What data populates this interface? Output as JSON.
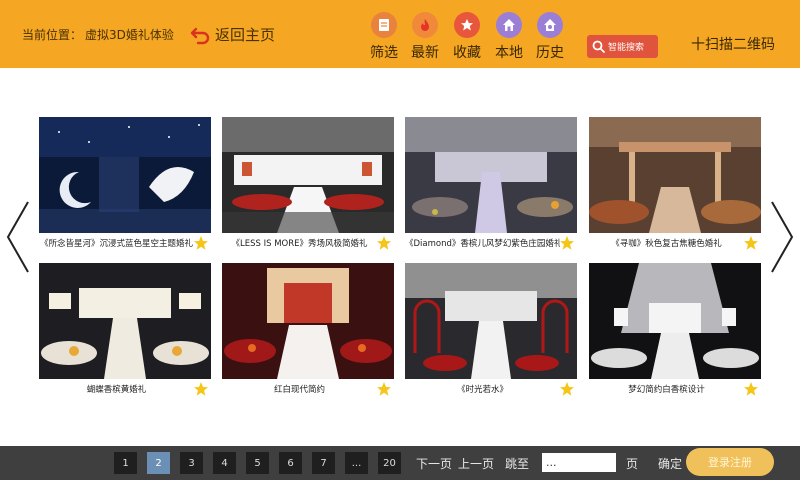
{
  "header": {
    "location_label": "当前位置：",
    "location_value": "虚拟3D婚礼体验",
    "back_label": "返回主页",
    "nav": [
      {
        "label": "筛选",
        "icon": "filter-icon",
        "color": "#e8823c"
      },
      {
        "label": "最新",
        "icon": "flame-icon",
        "color": "#f08a3a"
      },
      {
        "label": "收藏",
        "icon": "star-icon",
        "color": "#e8573c"
      },
      {
        "label": "本地",
        "icon": "home-icon",
        "color": "#9b7fd6"
      },
      {
        "label": "历史",
        "icon": "history-icon",
        "color": "#9b7fd6"
      }
    ],
    "search_label": "智能搜索",
    "qr_label": "十扫描二维码"
  },
  "cards": [
    {
      "caption": "《所念皆星河》沉浸式蓝色星空主题婚礼",
      "theme": "blue-starry"
    },
    {
      "caption": "《LESS IS MORE》秀场风极简婚礼",
      "theme": "red-white-runway"
    },
    {
      "caption": "《Diamond》香槟儿风梦幻紫色庄园婚礼",
      "theme": "purple-manor"
    },
    {
      "caption": "《寻咖》秋色复古焦糖色婚礼",
      "theme": "caramel-autumn"
    },
    {
      "caption": "蝴蝶香槟黄婚礼",
      "theme": "champagne-yellow"
    },
    {
      "caption": "红白现代简约",
      "theme": "red-white-modern"
    },
    {
      "caption": "《时光若水》",
      "theme": "red-arches"
    },
    {
      "caption": "梦幻简约白香槟设计",
      "theme": "white-champagne"
    }
  ],
  "pagination": {
    "pages": [
      "1",
      "2",
      "3",
      "4",
      "5",
      "6",
      "7",
      "...",
      "20"
    ],
    "active_page": "2",
    "next_label": "下一页",
    "prev_label": "上一页",
    "jump_label": "跳至",
    "jump_value": "...",
    "page_suffix": "页",
    "confirm_label": "确定",
    "confirm_overlay": "登录注册"
  },
  "colors": {
    "header_bg": "#f5a623",
    "footer_bg": "#3f3f3f",
    "active_page_bg": "#6b8fb5",
    "search_bg": "#e0533c",
    "star": "#f5c518"
  }
}
